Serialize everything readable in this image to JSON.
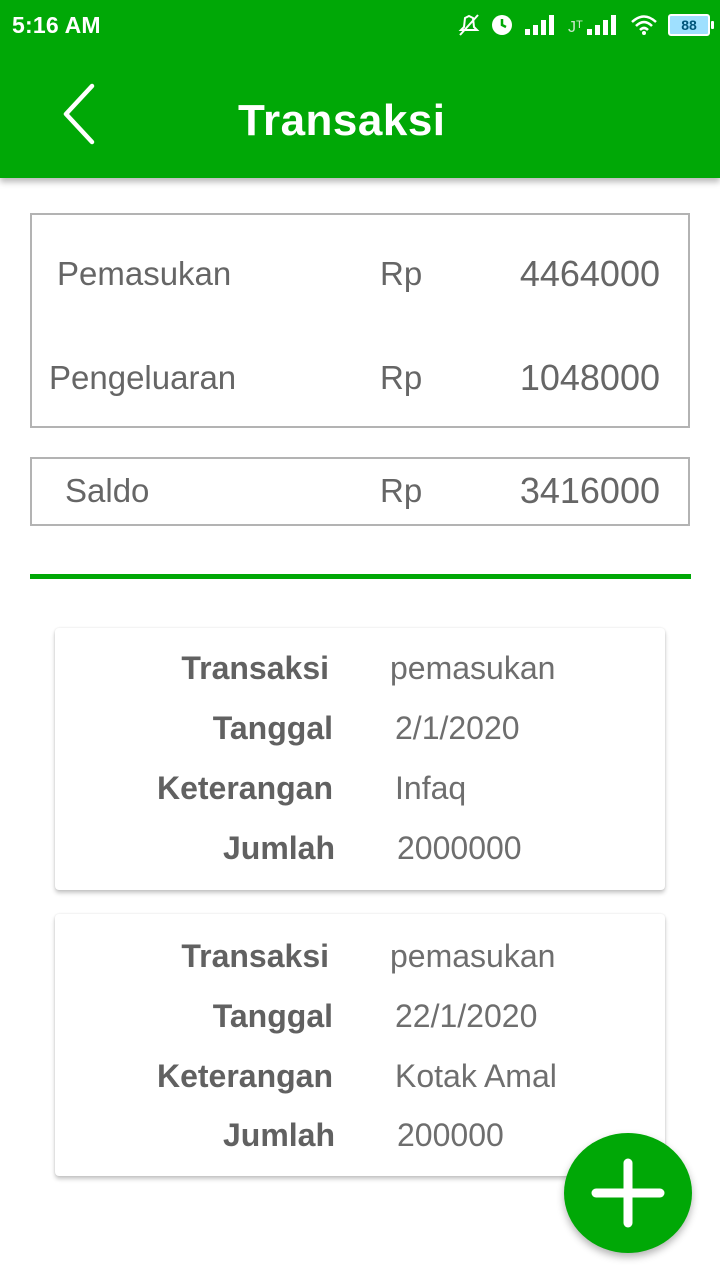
{
  "status_bar": {
    "time": "5:16 AM",
    "battery_level": "88",
    "icons": [
      "notification-muted-icon",
      "alarm-icon",
      "signal-icon",
      "signal-icon",
      "wifi-icon",
      "battery-icon"
    ]
  },
  "header": {
    "title": "Transaksi",
    "back_icon": "chevron-left-icon",
    "background_color": "#00a806"
  },
  "summary": {
    "pemasukan": {
      "label": "Pemasukan",
      "currency": "Rp",
      "amount": "4464000"
    },
    "pengeluaran": {
      "label": "Pengeluaran",
      "currency": "Rp",
      "amount": "1048000"
    },
    "saldo": {
      "label": "Saldo",
      "currency": "Rp",
      "amount": "3416000"
    }
  },
  "transactions": [
    {
      "labels": {
        "transaksi": "Transaksi",
        "tanggal": "Tanggal",
        "keterangan": "Keterangan",
        "jumlah": "Jumlah"
      },
      "transaksi": "pemasukan",
      "tanggal": "2/1/2020",
      "keterangan": "Infaq",
      "jumlah": "2000000"
    },
    {
      "labels": {
        "transaksi": "Transaksi",
        "tanggal": "Tanggal",
        "keterangan": "Keterangan",
        "jumlah": "Jumlah"
      },
      "transaksi": "pemasukan",
      "tanggal": "22/1/2020",
      "keterangan": "Kotak Amal",
      "jumlah": "200000"
    }
  ],
  "fab": {
    "icon": "plus-icon",
    "color": "#00a806"
  }
}
